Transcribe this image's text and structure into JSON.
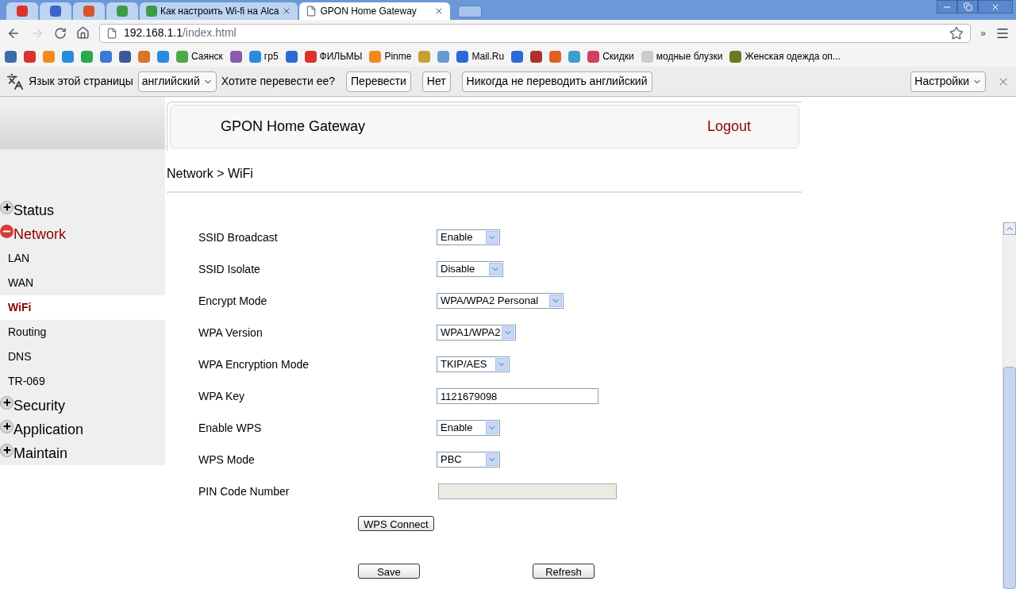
{
  "browser": {
    "tabs": [
      {
        "kind": "icon",
        "color": "#d9332b",
        "selected": false
      },
      {
        "kind": "icon",
        "color": "#3b63c9",
        "selected": false
      },
      {
        "kind": "icon",
        "color": "#d9532b",
        "selected": false
      },
      {
        "kind": "icon",
        "color": "#3e9a4a",
        "selected": false
      },
      {
        "kind": "page",
        "color": "#3e9a4a",
        "title": "Как настроить Wi-fi на Alca",
        "selected": false
      },
      {
        "kind": "page",
        "title": "GPON Home Gateway",
        "selected": true
      }
    ],
    "address": {
      "host": "192.168.1.1",
      "path": "/index.html"
    },
    "more": "»",
    "bookmarks": [
      {
        "color": "#3b6ea8"
      },
      {
        "color": "#d9332b"
      },
      {
        "color": "#f08a1c"
      },
      {
        "color": "#2a8ae0"
      },
      {
        "color": "#2aa84a"
      },
      {
        "color": "#3a7ad6"
      },
      {
        "color": "#3b5998"
      },
      {
        "color": "#d9742b"
      },
      {
        "color": "#2a8ae0"
      },
      {
        "color": "#4aa84a",
        "label": "Саянск"
      },
      {
        "color": "#8a5ab0"
      },
      {
        "color": "#2a8ae0",
        "label": "гр5"
      },
      {
        "color": "#2a6ad6"
      },
      {
        "color": "#d9332b",
        "label": "ФИЛЬМЫ"
      },
      {
        "color": "#f08a1c",
        "label": "Pinme"
      },
      {
        "color": "#c8a030"
      },
      {
        "color": "#6a9ad6"
      },
      {
        "color": "#2a6ad6",
        "label": "Mail.Ru"
      },
      {
        "color": "#2a6ad6"
      },
      {
        "color": "#b03030"
      },
      {
        "color": "#e06020"
      },
      {
        "color": "#3aa0d0"
      },
      {
        "color": "#d04060",
        "label": "Скидки"
      },
      {
        "color": "#cccccc",
        "label": "модные блузки"
      },
      {
        "color": "#6a7a20",
        "label": "Женская одежда оп..."
      }
    ],
    "translate_bar": {
      "prompt": "Язык этой страницы",
      "language": "английский",
      "question": "Хотите перевести ее?",
      "buttons": [
        "Перевести",
        "Нет",
        "Никогда не переводить английский"
      ],
      "options": "Настройки"
    }
  },
  "page": {
    "header": {
      "title": "GPON Home Gateway",
      "logout": "Logout"
    },
    "breadcrumb": "Network > WiFi",
    "menu": [
      {
        "label": "Status",
        "expanded": false
      },
      {
        "label": "Network",
        "expanded": true,
        "children": [
          {
            "label": "LAN",
            "selected": false
          },
          {
            "label": "WAN",
            "selected": false
          },
          {
            "label": "WiFi",
            "selected": true
          },
          {
            "label": "Routing",
            "selected": false
          },
          {
            "label": "DNS",
            "selected": false
          },
          {
            "label": "TR-069",
            "selected": false
          }
        ]
      },
      {
        "label": "Security",
        "expanded": false
      },
      {
        "label": "Application",
        "expanded": false
      },
      {
        "label": "Maintain",
        "expanded": false
      }
    ],
    "form": [
      {
        "kind": "select",
        "label": "SSID Broadcast",
        "value": "Enable"
      },
      {
        "kind": "select",
        "label": "SSID Isolate",
        "value": "Disable"
      },
      {
        "kind": "select",
        "label": "Encrypt Mode",
        "value": "WPA/WPA2 Personal"
      },
      {
        "kind": "select",
        "label": "WPA Version",
        "value": "WPA1/WPA2"
      },
      {
        "kind": "select",
        "label": "WPA Encryption Mode",
        "value": "TKIP/AES"
      },
      {
        "kind": "text",
        "label": "WPA Key",
        "value": "1121679098",
        "disabled": false
      },
      {
        "kind": "select",
        "label": "Enable WPS",
        "value": "Enable"
      },
      {
        "kind": "select",
        "label": "WPS Mode",
        "value": "PBC"
      },
      {
        "kind": "text",
        "label": "PIN Code Number",
        "disabled": true
      }
    ],
    "wps_button": "WPS Connect",
    "actions": [
      "Save",
      "Refresh"
    ]
  }
}
